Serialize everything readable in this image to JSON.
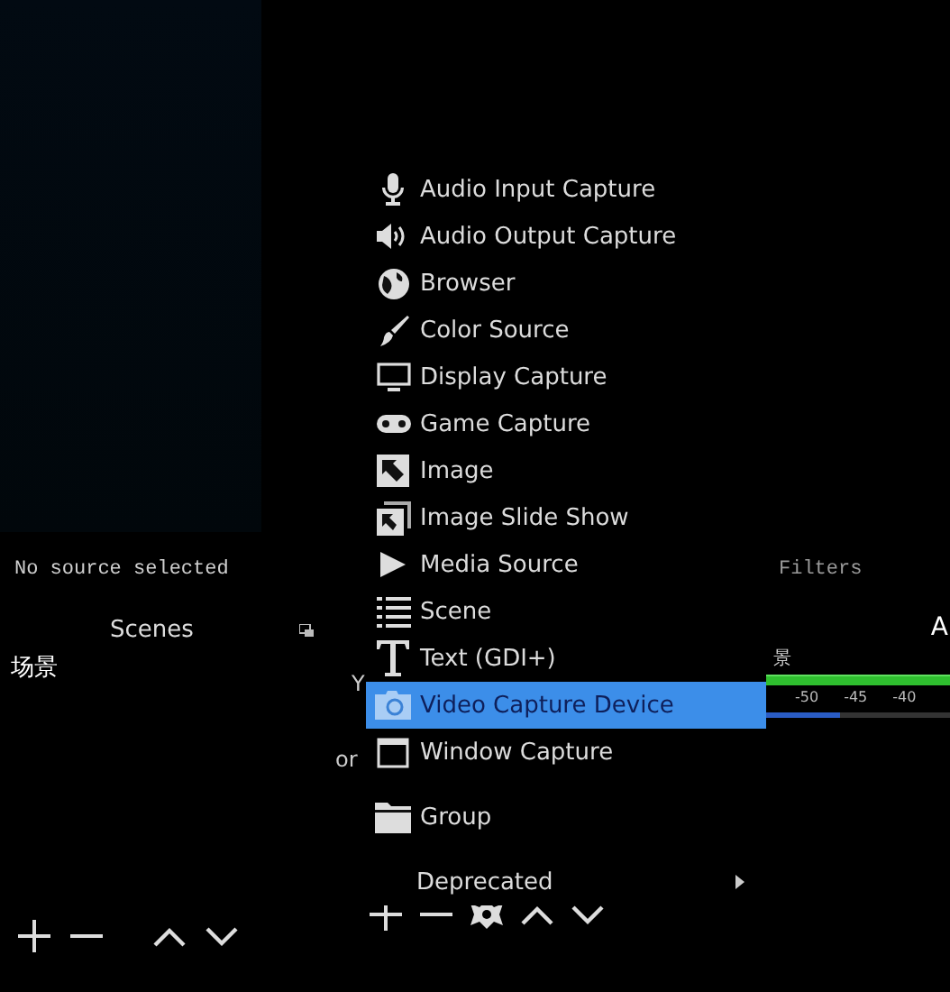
{
  "properties_bar": {
    "text": "No source selected",
    "filters_label": "Filters"
  },
  "scenes_dock": {
    "title": "Scenes",
    "items": [
      "场景"
    ]
  },
  "sources_dock": {
    "visible_fragments": [
      "Y",
      "or"
    ]
  },
  "mixer_dock": {
    "title_fragment": "A",
    "channel_fragment": "景",
    "meter_ticks": [
      "-50",
      "-45",
      "-40"
    ],
    "volume_slider": {
      "level": 0.4
    }
  },
  "add_source_menu": [
    {
      "kind": "item",
      "label": "Audio Input Capture",
      "selected": false
    },
    {
      "kind": "item",
      "label": "Audio Output Capture",
      "selected": false
    },
    {
      "kind": "item",
      "label": "Browser",
      "selected": false
    },
    {
      "kind": "item",
      "label": "Color Source",
      "selected": false
    },
    {
      "kind": "item",
      "label": "Display Capture",
      "selected": false
    },
    {
      "kind": "item",
      "label": "Game Capture",
      "selected": false
    },
    {
      "kind": "item",
      "label": "Image",
      "selected": false
    },
    {
      "kind": "item",
      "label": "Image Slide Show",
      "selected": false
    },
    {
      "kind": "item",
      "label": "Media Source",
      "selected": false
    },
    {
      "kind": "item",
      "label": "Scene",
      "selected": false
    },
    {
      "kind": "item",
      "label": "Text (GDI+)",
      "selected": false
    },
    {
      "kind": "item",
      "label": "Video Capture Device",
      "selected": true
    },
    {
      "kind": "item",
      "label": "Window Capture",
      "selected": false
    },
    {
      "kind": "separator"
    },
    {
      "kind": "item",
      "label": "Group",
      "selected": false
    },
    {
      "kind": "separator"
    },
    {
      "kind": "submenu",
      "label": "Deprecated",
      "selected": false
    }
  ]
}
